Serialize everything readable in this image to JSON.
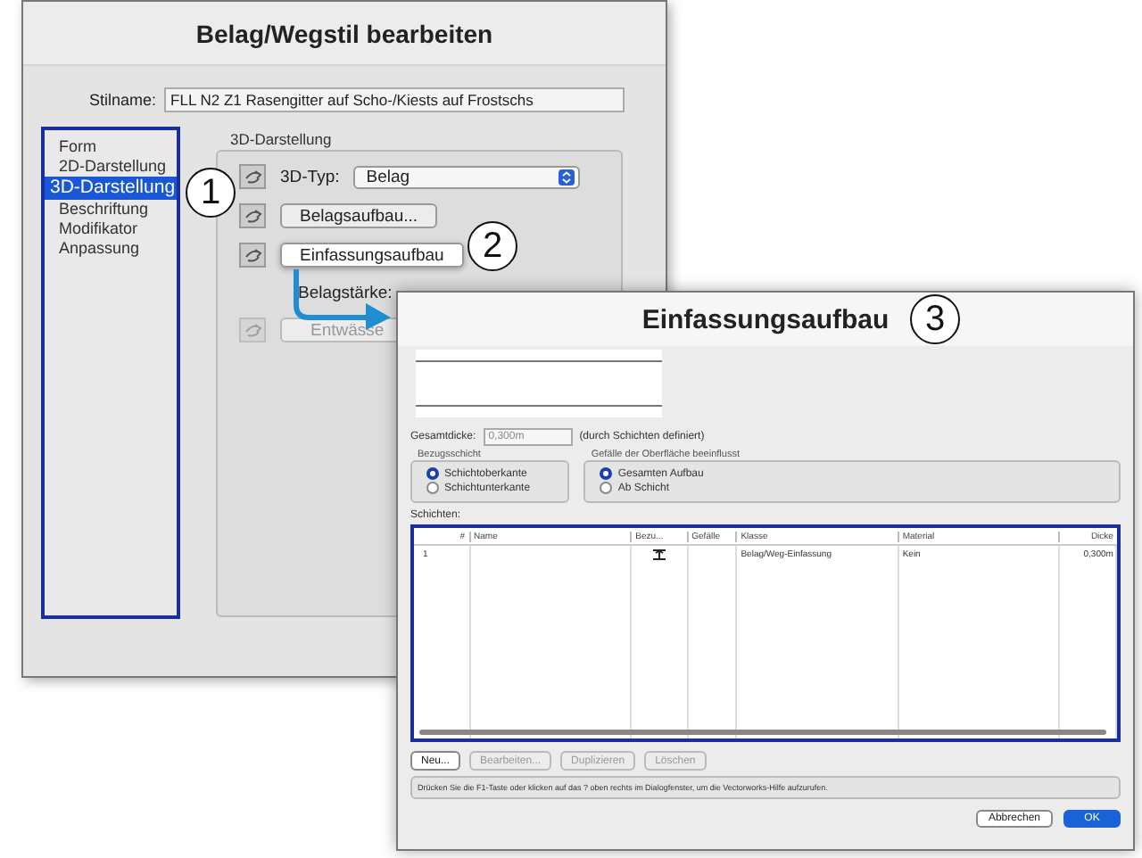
{
  "main_dialog": {
    "title": "Belag/Wegstil bearbeiten",
    "style_name_label": "Stilname:",
    "style_name": "FLL N2 Z1 Rasengitter auf Scho-/Kiests auf Frostschs",
    "sidebar": {
      "items": [
        {
          "label": "Form",
          "selected": false
        },
        {
          "label": "2D-Darstellung",
          "selected": false
        },
        {
          "label": "3D-Darstellung",
          "selected": true
        },
        {
          "label": "Beschriftung",
          "selected": false
        },
        {
          "label": "Modifikator",
          "selected": false
        },
        {
          "label": "Anpassung",
          "selected": false
        }
      ]
    },
    "group": {
      "title": "3D-Darstellung",
      "type_label": "3D-Typ:",
      "type_value": "Belag",
      "buttons": [
        {
          "label": "Belagsaufbau...",
          "disabled": false,
          "highlighted": false
        },
        {
          "label": "Einfassungsaufbau",
          "disabled": false,
          "highlighted": true
        }
      ],
      "thickness_label": "Belagstärke:",
      "drain_button": {
        "label": "Entwässe",
        "disabled": true
      }
    }
  },
  "callouts": [
    "1",
    "2",
    "3"
  ],
  "sub_dialog": {
    "title": "Einfassungsaufbau",
    "total_label": "Gesamtdicke:",
    "total_value": "0,300m",
    "total_note": "(durch Schichten definiert)",
    "reference": {
      "title": "Bezugsschicht",
      "options": [
        {
          "label": "Schichtoberkante",
          "selected": true
        },
        {
          "label": "Schichtunterkante",
          "selected": false
        }
      ]
    },
    "slope": {
      "title": "Gefälle der Oberfläche beeinflusst",
      "options": [
        {
          "label": "Gesamten Aufbau",
          "selected": true
        },
        {
          "label": "Ab Schicht",
          "selected": false
        }
      ]
    },
    "layers_label": "Schichten:",
    "table": {
      "columns": [
        "#",
        "Name",
        "Bezu...",
        "Gefälle",
        "Klasse",
        "Material",
        "Dicke"
      ],
      "rows": [
        {
          "number": "1",
          "class": "Belag/Weg-Einfassung",
          "material": "Kein",
          "thickness": "0,300m"
        }
      ]
    },
    "actions": [
      {
        "label": "Neu...",
        "disabled": false
      },
      {
        "label": "Bearbeiten...",
        "disabled": true
      },
      {
        "label": "Duplizieren",
        "disabled": true
      },
      {
        "label": "Löschen",
        "disabled": true
      }
    ],
    "help": "Drücken Sie die F1-Taste oder klicken auf das ? oben rechts im Dialogfenster, um die Vectorworks-Hilfe aufzurufen.",
    "buttons": [
      {
        "label": "Abbrechen",
        "kind": "secondary"
      },
      {
        "label": "OK",
        "kind": "primary"
      }
    ]
  }
}
